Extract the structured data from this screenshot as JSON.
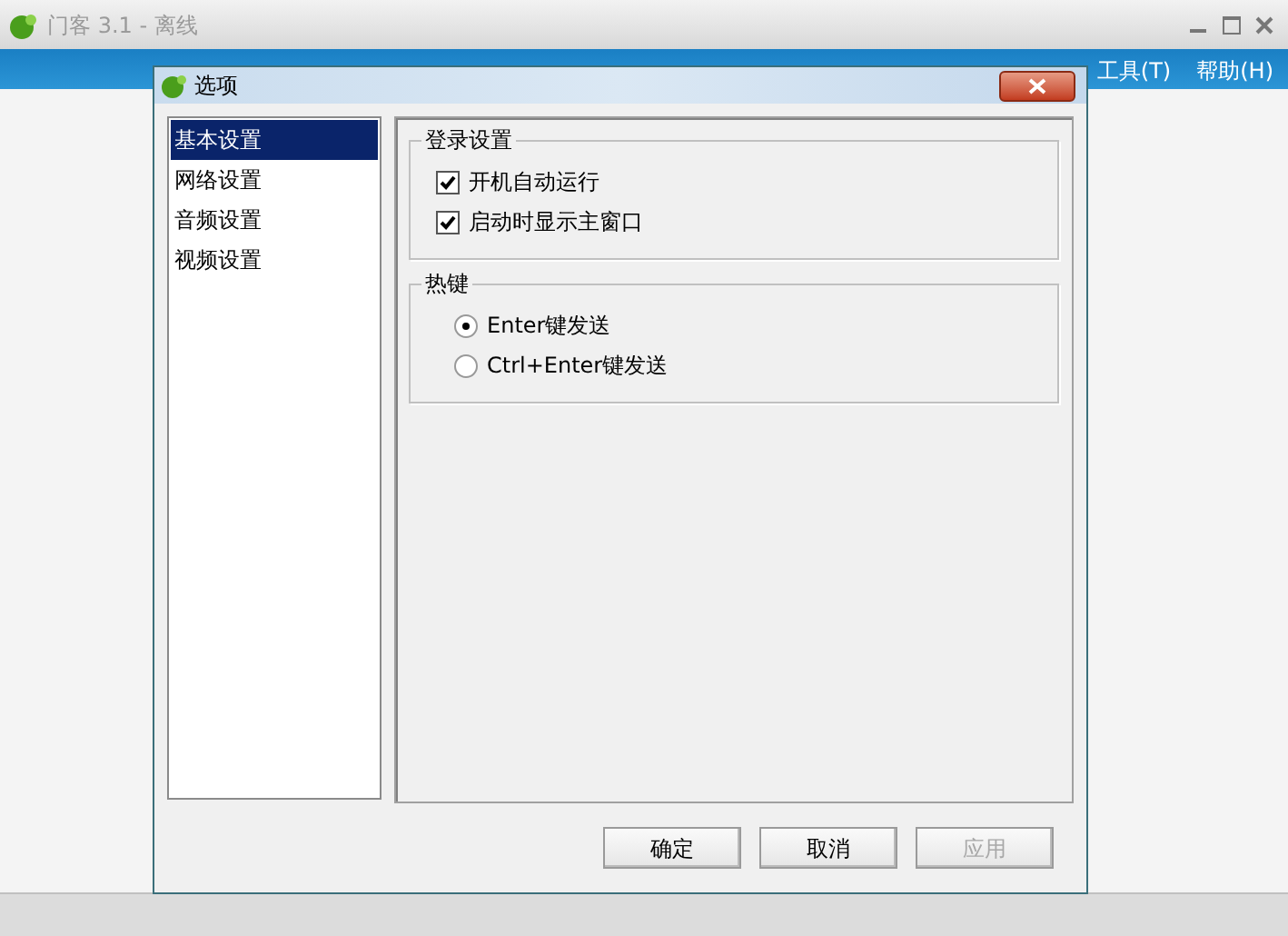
{
  "main_window": {
    "title": "门客 3.1 - 离线",
    "menu": [
      {
        "label": "工具(T)"
      },
      {
        "label": "帮助(H)"
      }
    ]
  },
  "dialog": {
    "title": "选项",
    "categories": [
      {
        "label": "基本设置",
        "selected": true
      },
      {
        "label": "网络设置",
        "selected": false
      },
      {
        "label": "音频设置",
        "selected": false
      },
      {
        "label": "视频设置",
        "selected": false
      }
    ],
    "groups": [
      {
        "title": "登录设置",
        "options": [
          {
            "kind": "checkbox",
            "label": "开机自动运行",
            "checked": true
          },
          {
            "kind": "checkbox",
            "label": "启动时显示主窗口",
            "checked": true
          }
        ]
      },
      {
        "title": "热键",
        "options": [
          {
            "kind": "radio",
            "label": "Enter键发送",
            "selected": true
          },
          {
            "kind": "radio",
            "label": "Ctrl+Enter键发送",
            "selected": false
          }
        ]
      }
    ],
    "buttons": [
      {
        "label": "确定",
        "disabled": false
      },
      {
        "label": "取消",
        "disabled": false
      },
      {
        "label": "应用",
        "disabled": true
      }
    ]
  }
}
